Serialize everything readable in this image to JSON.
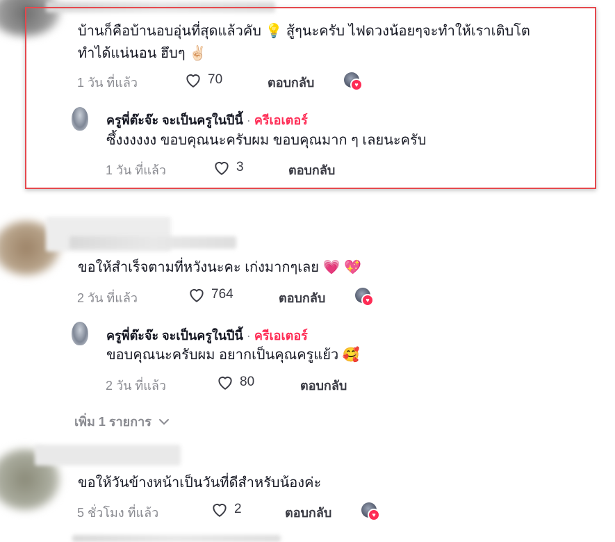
{
  "comments": [
    {
      "text": "บ้านก็คือบ้านอบอุ่นที่สุดแล้วคับ 💡  สู้ๆนะครับ ไฟดวงน้อยๆจะทำให้เราเติบโต",
      "text2": "ทำได้แน่นอน ฮึบๆ ✌🏻",
      "time": "1 วัน ที่แล้ว",
      "likes": "70",
      "reply_label": "ตอบกลับ",
      "reply": {
        "name": "ครูพี่ต๊ะจ๊ะ จะเป็นครูในปีนี้",
        "separator": "·",
        "creator_label": "ครีเอเตอร์",
        "text": "ซึ้งงงงงง ขอบคุณนะครับผม ขอบคุณมาก ๆ เลยนะครับ",
        "time": "1 วัน ที่แล้ว",
        "likes": "3",
        "reply_label": "ตอบกลับ"
      }
    },
    {
      "text": "ขอให้สำเร็จตามที่หวังนะคะ เก่งมากๆเลย 💗 💖",
      "time": "2 วัน ที่แล้ว",
      "likes": "764",
      "reply_label": "ตอบกลับ",
      "reply": {
        "name": "ครูพี่ต๊ะจ๊ะ จะเป็นครูในปีนี้",
        "separator": "·",
        "creator_label": "ครีเอเตอร์",
        "text": "ขอบคุณนะครับผม อยากเป็นคุณครูแย้ว 🥰",
        "time": "2 วัน ที่แล้ว",
        "likes": "80",
        "reply_label": "ตอบกลับ"
      },
      "view_more": "เพิ่ม 1 รายการ"
    },
    {
      "text": "ขอให้วันข้างหน้าเป็นวันที่ดีสำหรับน้องค่ะ",
      "time": "5 ชั่วโมง ที่แล้ว",
      "likes": "2",
      "reply_label": "ตอบกลับ"
    }
  ],
  "colors": {
    "creator": "#fe2c55",
    "highlight": "#e5484d",
    "muted": "#8a8b91"
  },
  "icons": [
    "heart-outline-icon",
    "creator-liked-icon",
    "chevron-down-icon"
  ]
}
